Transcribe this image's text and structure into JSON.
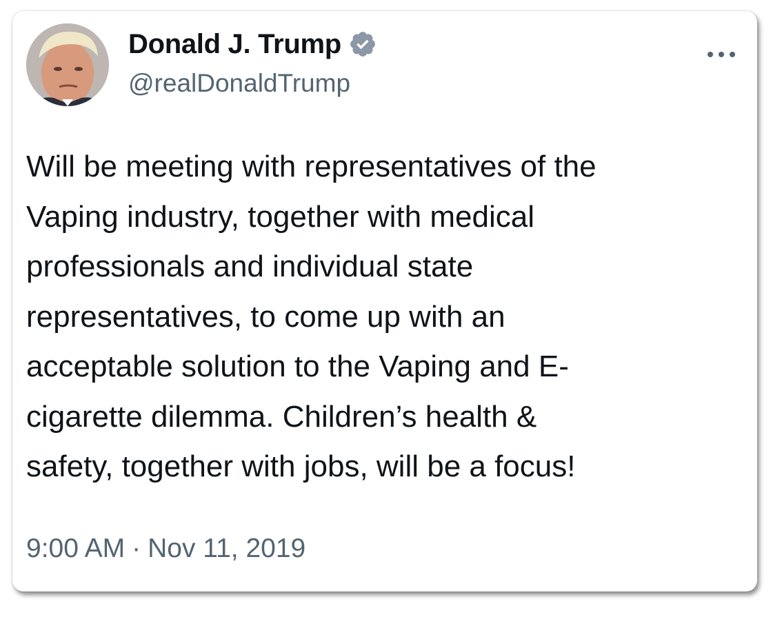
{
  "tweet": {
    "author": {
      "name": "Donald J. Trump",
      "handle": "@realDonaldTrump",
      "verified": true,
      "verified_badge_color": "#8b98a5"
    },
    "text": "Will be meeting with representatives of the\nVaping industry, together with medical\nprofessionals and individual state\nrepresentatives, to come up with an\nacceptable solution to the Vaping and E-\ncigarette dilemma. Children’s health &\nsafety, together with jobs, will be a focus!",
    "time": "9:00 AM",
    "separator": "·",
    "date": "Nov 11, 2019",
    "icons": {
      "more": "more-horizontal-icon",
      "verified": "verified-badge-icon"
    }
  }
}
